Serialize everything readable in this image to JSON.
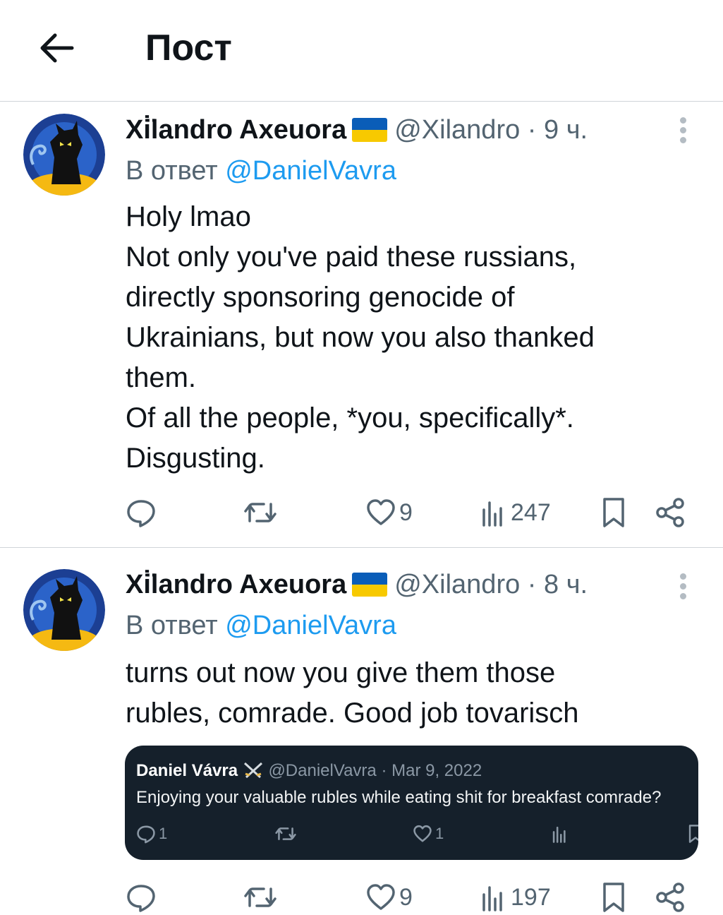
{
  "header": {
    "title": "Пост"
  },
  "tweets": [
    {
      "author_name": "Xi̇̈landro Axeuora",
      "handle": "@Xilandro",
      "separator": "·",
      "time": "9 ч.",
      "reply_prefix": "В ответ",
      "reply_to": "@DanielVavra",
      "body_lines": [
        "Holy lmao",
        "Not only you've paid these russians,",
        "directly sponsoring genocide of",
        "Ukrainians, but now you also thanked",
        "them.",
        "Of all the people, *you, specifically*.",
        "Disgusting."
      ],
      "likes": "9",
      "views": "247"
    },
    {
      "author_name": "Xi̇̈landro Axeuora",
      "handle": "@Xilandro",
      "separator": "·",
      "time": "8 ч.",
      "reply_prefix": "В ответ",
      "reply_to": "@DanielVavra",
      "body_lines": [
        "turns out now you give them those",
        "rubles, comrade. Good job tovarisch"
      ],
      "likes": "9",
      "views": "197",
      "quote": {
        "author_name": "Daniel Vávra",
        "handle": "@DanielVavra",
        "separator": "·",
        "date": "Mar 9, 2022",
        "text": "Enjoying your valuable rubles while eating shit for breakfast comrade?",
        "replies": "1",
        "likes": "1"
      }
    }
  ],
  "icons": {
    "back": "arrow-left-icon",
    "reply": "speech-bubble-icon",
    "retweet": "retweet-arrows-icon",
    "like": "heart-icon",
    "views": "bar-chart-icon",
    "bookmark": "bookmark-icon",
    "share": "share-icon",
    "more": "vertical-dots-icon",
    "flag": "ukraine-flag-icon",
    "swords": "crossed-swords-icon"
  },
  "colors": {
    "link": "#1d9bf0",
    "secondary_text": "#536471",
    "primary_text": "#0f1419",
    "quote_background": "#15202b",
    "flag_blue": "#0a5db8",
    "flag_yellow": "#f7c900"
  }
}
